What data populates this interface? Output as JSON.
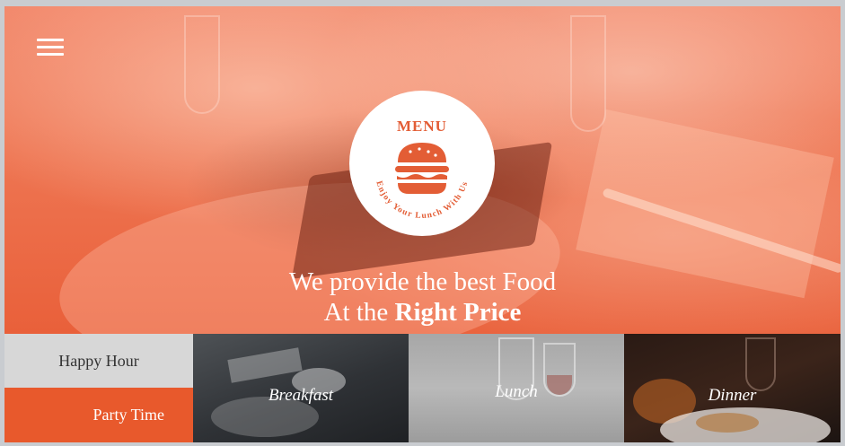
{
  "header": {
    "menu_icon": "hamburger-icon"
  },
  "logo": {
    "title": "MENU",
    "tagline": "Enjoy Your Lunch With Us",
    "icon": "burger-icon",
    "color": "#e35d35"
  },
  "hero": {
    "line1": "We provide the best Food",
    "line2_prefix": "At the",
    "line2_bold": "Right Price"
  },
  "tabs": [
    {
      "label": "Happy Hour",
      "color": "#d7d7d7"
    },
    {
      "label": "Party Time",
      "color": "#e8592c"
    }
  ],
  "tiles": [
    {
      "label": "Breakfast"
    },
    {
      "label": "Lunch"
    },
    {
      "label": "Dinner"
    }
  ]
}
